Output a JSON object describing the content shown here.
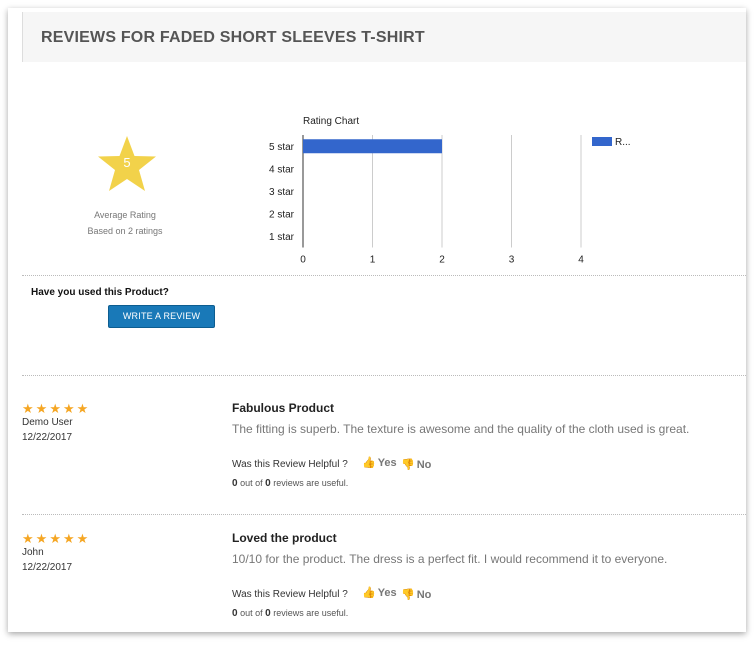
{
  "header": {
    "title": "REVIEWS FOR FADED SHORT SLEEVES T-SHIRT"
  },
  "average": {
    "value": "5",
    "label": "Average Rating",
    "count_text": "Based on 2 ratings",
    "star_color": "#f2d24a"
  },
  "chart_data": {
    "type": "bar",
    "orientation": "horizontal",
    "title": "Rating Chart",
    "categories": [
      "5 star",
      "4 star",
      "3 star",
      "2 star",
      "1 star"
    ],
    "series": [
      {
        "name": "R...",
        "values": [
          2,
          0,
          0,
          0,
          0
        ],
        "color": "#3366cc"
      }
    ],
    "xlim": [
      0,
      4
    ],
    "xticks": [
      "0",
      "1",
      "2",
      "3",
      "4"
    ],
    "grid": true,
    "legend": "top-right"
  },
  "cta": {
    "question": "Have you used this Product?",
    "button_label": "WRITE A REVIEW",
    "button_color": "#1979b8"
  },
  "reviews": [
    {
      "stars": 5,
      "reviewer": "Demo User",
      "date": "12/22/2017",
      "title": "Fabulous Product",
      "body": "The fitting is superb. The texture is awesome and the quality of the cloth used is great.",
      "helpful_question": "Was this Review Helpful ?",
      "yes_label": "Yes",
      "no_label": "No",
      "useful_count": "0",
      "out_of": "out of",
      "total_count": "0",
      "useful_suffix": "reviews are useful."
    },
    {
      "stars": 5,
      "reviewer": "John",
      "date": "12/22/2017",
      "title": "Loved the product",
      "body": "10/10 for the product. The dress is a perfect fit. I would recommend it to everyone.",
      "helpful_question": "Was this Review Helpful ?",
      "yes_label": "Yes",
      "no_label": "No",
      "useful_count": "0",
      "out_of": "out of",
      "total_count": "0",
      "useful_suffix": "reviews are useful."
    }
  ],
  "colors": {
    "star": "#f5a623",
    "accent": "#1979b8"
  }
}
